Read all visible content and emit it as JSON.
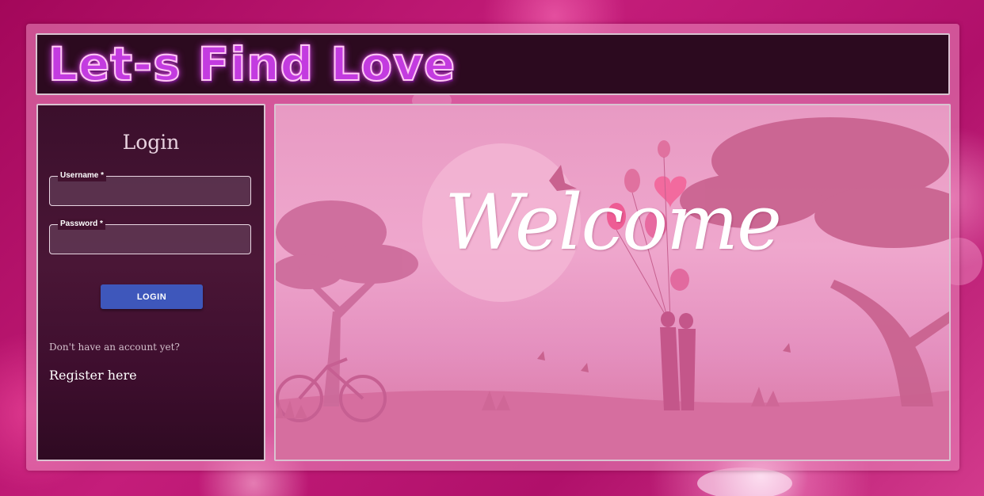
{
  "header": {
    "logo_text": "Let-s Find Love"
  },
  "login": {
    "title": "Login",
    "username_label": "Username *",
    "username_value": "",
    "password_label": "Password *",
    "password_value": "",
    "button_label": "LOGIN",
    "no_account_text": "Don't have an account yet?",
    "register_link": "Register here"
  },
  "hero": {
    "welcome_text": "Welcome"
  },
  "colors": {
    "page_background": "#c41d7a",
    "header_background": "#2c0a1f",
    "login_panel_background": "#3b0f2c",
    "login_button": "#3e57bb",
    "hero_background": "#e89ac3"
  }
}
